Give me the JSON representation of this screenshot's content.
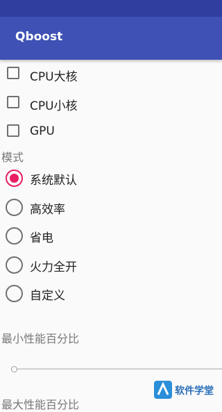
{
  "app": {
    "title": "Qboost"
  },
  "cores": [
    {
      "label": "CPU大核",
      "checked": false
    },
    {
      "label": "CPU小核",
      "checked": false
    },
    {
      "label": "GPU",
      "checked": false
    }
  ],
  "mode": {
    "label": "模式",
    "options": [
      {
        "label": "系统默认",
        "selected": true
      },
      {
        "label": "高效率",
        "selected": false
      },
      {
        "label": "省电",
        "selected": false
      },
      {
        "label": "火力全开",
        "selected": false
      },
      {
        "label": "自定义",
        "selected": false
      }
    ]
  },
  "min_perf": {
    "label": "最小性能百分比",
    "value": 0
  },
  "max_perf": {
    "label": "最大性能百分比"
  },
  "watermark": {
    "text": "软件学堂"
  },
  "colors": {
    "primary": "#3f51b5",
    "status_bar": "#303f9f",
    "accent": "#e91e63"
  }
}
